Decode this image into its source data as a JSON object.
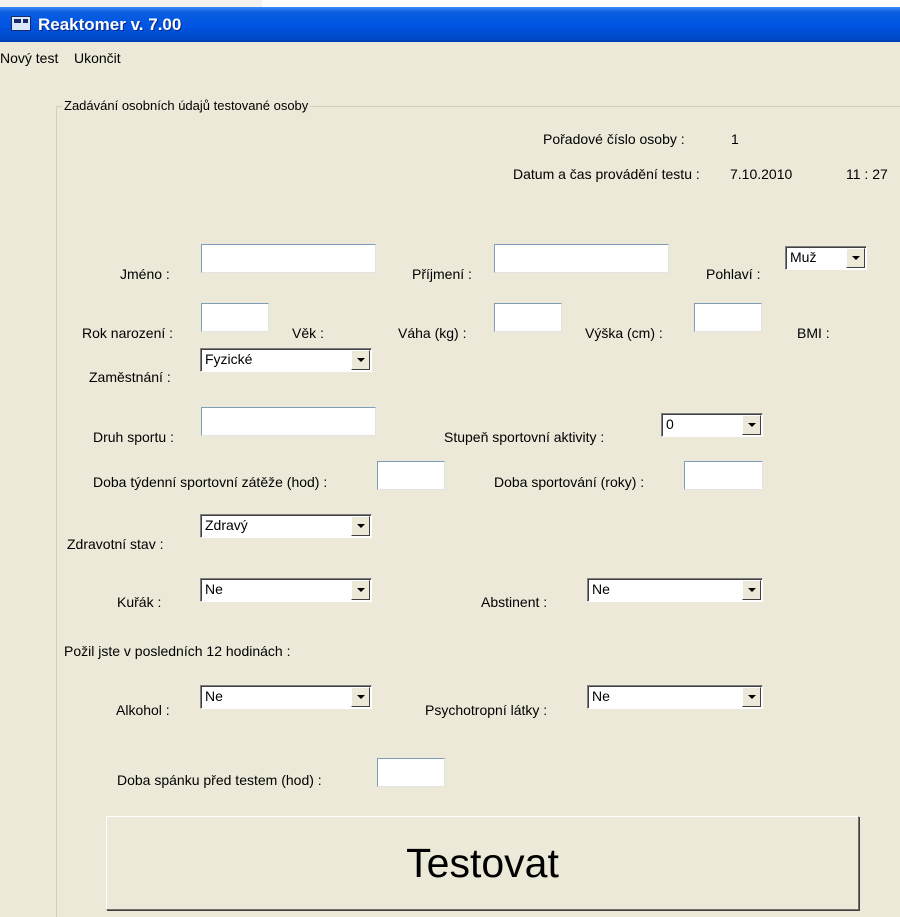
{
  "window": {
    "title": "Reaktomer v. 7.00"
  },
  "menu": {
    "items": [
      "Nový test",
      "Ukončit"
    ]
  },
  "group": {
    "caption": "Zadávání osobních údajů testované osoby"
  },
  "info": {
    "person_number_label": "Pořadové číslo osoby :",
    "person_number_value": "1",
    "datetime_label": "Datum a čas provádění testu :",
    "date_value": "7.10.2010",
    "time_value": "11 : 27"
  },
  "fields": {
    "first_name": {
      "label": "Jméno :",
      "value": ""
    },
    "last_name": {
      "label": "Příjmení :",
      "value": ""
    },
    "gender": {
      "label": "Pohlaví :",
      "value": "Muž"
    },
    "birth_year": {
      "label": "Rok narození :",
      "value": ""
    },
    "age": {
      "label": "Věk :"
    },
    "weight": {
      "label": "Váha (kg) :",
      "value": ""
    },
    "height": {
      "label": "Výška (cm) :",
      "value": ""
    },
    "bmi": {
      "label": "BMI :"
    },
    "employment": {
      "label": "Zaměstnání :",
      "value": "Fyzické"
    },
    "sport_type": {
      "label": "Druh sportu :",
      "value": ""
    },
    "sport_level": {
      "label": "Stupeň sportovní aktivity :",
      "value": "0"
    },
    "weekly_sport_hours": {
      "label": "Doba týdenní sportovní zátěže (hod) :",
      "value": ""
    },
    "sport_years": {
      "label": "Doba sportování (roky) :",
      "value": ""
    },
    "health": {
      "label": "Zdravotní stav :",
      "value": "Zdravý"
    },
    "smoker": {
      "label": "Kuřák :",
      "value": "Ne"
    },
    "abstinent": {
      "label": "Abstinent :",
      "value": "Ne"
    },
    "consumed_heading": "Požil jste v posledních 12 hodinách :",
    "alcohol": {
      "label": "Alkohol :",
      "value": "Ne"
    },
    "psychotropic": {
      "label": "Psychotropní látky :",
      "value": "Ne"
    },
    "sleep_hours": {
      "label": "Doba spánku před testem (hod) :",
      "value": ""
    }
  },
  "actions": {
    "test_button": "Testovat"
  },
  "colors": {
    "titlebar": "#0054e3",
    "window_bg": "#ece9d8"
  },
  "icons": {
    "app_icon": "app-icon"
  }
}
